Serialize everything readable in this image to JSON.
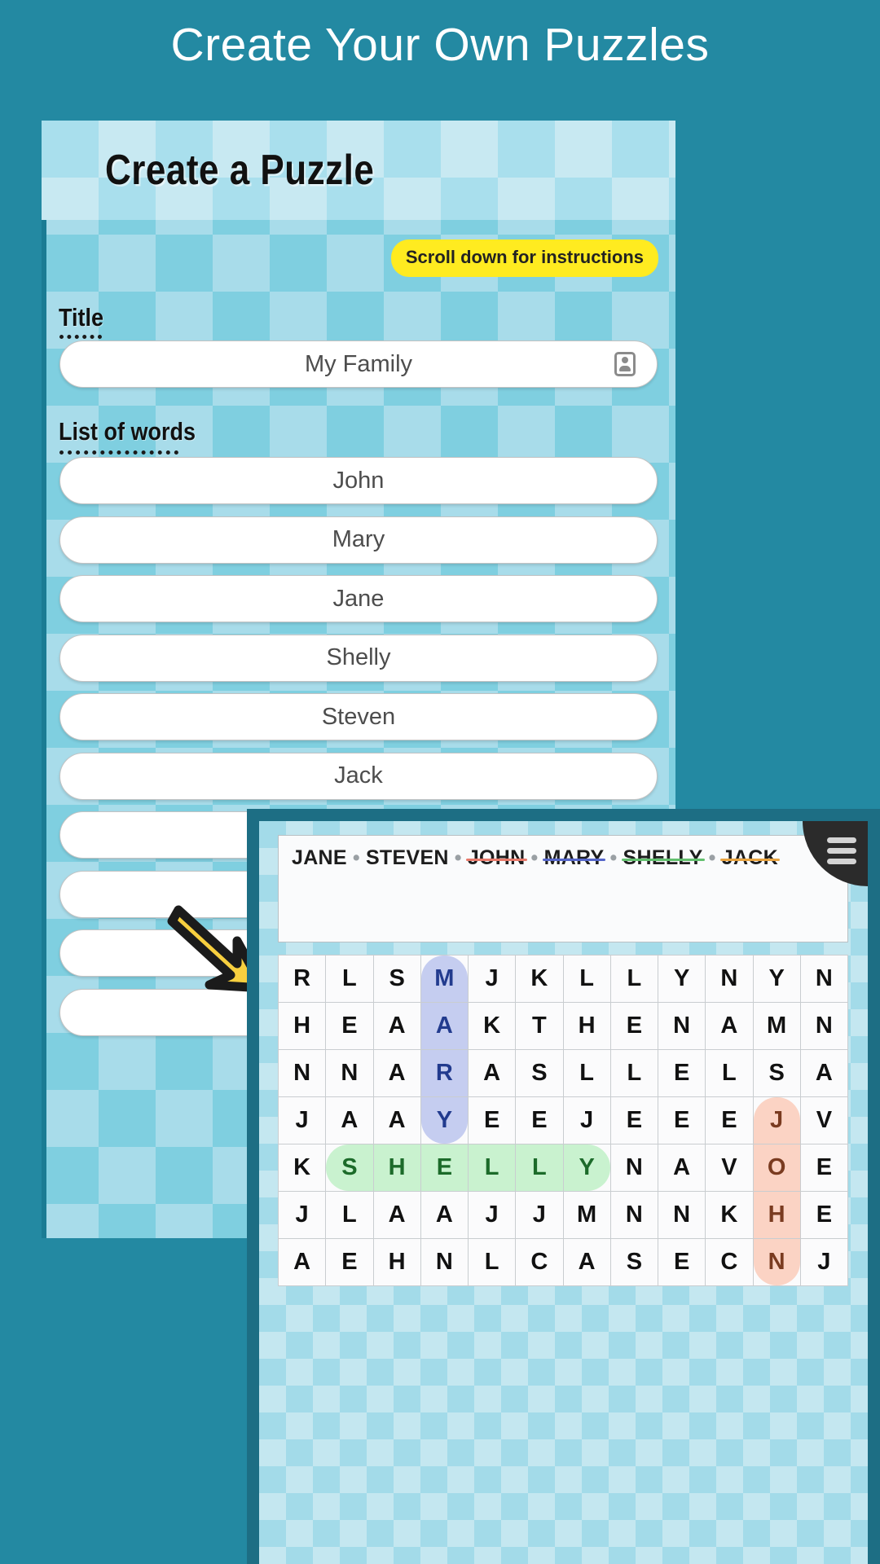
{
  "headline": "Create Your Own Puzzles",
  "card": {
    "title": "Create a Puzzle",
    "scroll_pill": "Scroll down for instructions",
    "title_label": "Title",
    "title_value": "My Family",
    "title_icon": "contact-card-icon",
    "words_label": "List of words",
    "words": [
      "John",
      "Mary",
      "Jane",
      "Shelly",
      "Steven",
      "Jack",
      "",
      "",
      "",
      ""
    ]
  },
  "arrow": {
    "icon": "arrow-down-right-icon",
    "color": "#f7cf3f",
    "outline": "#1b1b1b"
  },
  "wordsearch": {
    "menu_icon": "hamburger-menu-icon",
    "word_list": [
      {
        "text": "JANE",
        "found": false,
        "color": "#1d1d1d"
      },
      {
        "text": "STEVEN",
        "found": false,
        "color": "#1d1d1d"
      },
      {
        "text": "JOHN",
        "found": true,
        "color": "#e8796a"
      },
      {
        "text": "MARY",
        "found": true,
        "color": "#5566c9"
      },
      {
        "text": "SHELLY",
        "found": true,
        "color": "#62c06e"
      },
      {
        "text": "JACK",
        "found": true,
        "color": "#e8a33f"
      }
    ],
    "separator": "•",
    "grid_rows": 7,
    "grid_cols": 12,
    "grid": [
      [
        "R",
        "L",
        "S",
        "M",
        "J",
        "K",
        "L",
        "L",
        "Y",
        "N",
        "Y",
        "N"
      ],
      [
        "H",
        "E",
        "A",
        "A",
        "K",
        "T",
        "H",
        "E",
        "N",
        "A",
        "M",
        "N"
      ],
      [
        "N",
        "N",
        "A",
        "R",
        "A",
        "S",
        "L",
        "L",
        "E",
        "L",
        "S",
        "A"
      ],
      [
        "J",
        "A",
        "A",
        "Y",
        "E",
        "E",
        "J",
        "E",
        "E",
        "E",
        "J",
        "V"
      ],
      [
        "K",
        "S",
        "H",
        "E",
        "L",
        "L",
        "Y",
        "N",
        "A",
        "V",
        "O",
        "E"
      ],
      [
        "J",
        "L",
        "A",
        "A",
        "J",
        "J",
        "M",
        "N",
        "N",
        "K",
        "H",
        "E"
      ],
      [
        "A",
        "E",
        "H",
        "N",
        "L",
        "C",
        "A",
        "S",
        "E",
        "C",
        "N",
        "J"
      ]
    ],
    "highlights": [
      {
        "word": "MARY",
        "style": "blue",
        "cells": [
          [
            0,
            3
          ],
          [
            1,
            3
          ],
          [
            2,
            3
          ],
          [
            3,
            3
          ]
        ]
      },
      {
        "word": "SHELLY",
        "style": "green",
        "cells": [
          [
            4,
            1
          ],
          [
            4,
            2
          ],
          [
            4,
            3
          ],
          [
            4,
            4
          ],
          [
            4,
            5
          ],
          [
            4,
            6
          ]
        ]
      },
      {
        "word": "JOHN",
        "style": "peach",
        "cells": [
          [
            3,
            10
          ],
          [
            4,
            10
          ],
          [
            5,
            10
          ],
          [
            6,
            10
          ]
        ]
      }
    ]
  },
  "colors": {
    "page_bg": "#2389a2",
    "card_check_light": "#a8dcea",
    "card_check_dark": "#7fcfe0",
    "pill_yellow": "#ffeb20",
    "overlay_frame": "#1d6e84",
    "menu_dark": "#2b2b2b"
  }
}
